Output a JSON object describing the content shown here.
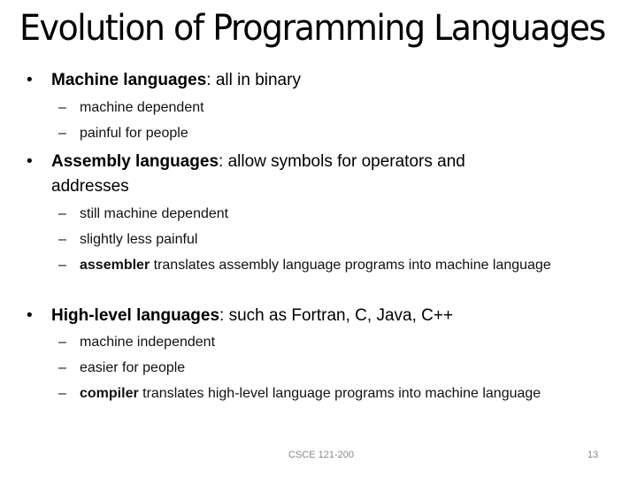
{
  "slide": {
    "title": "Evolution of Programming Languages",
    "bullets": [
      {
        "term": "Machine languages",
        "rest": ":  all in binary",
        "subs": [
          {
            "bold": "",
            "text": "machine dependent"
          },
          {
            "bold": "",
            "text": "painful for people"
          }
        ]
      },
      {
        "term": "Assembly languages",
        "rest": ":  allow symbols for operators and addresses",
        "subs": [
          {
            "bold": "",
            "text": "still machine dependent"
          },
          {
            "bold": "",
            "text": "slightly less painful"
          },
          {
            "bold": "assembler",
            "text": " translates assembly language programs into machine language"
          }
        ]
      },
      {
        "term": "High-level languages",
        "rest": ":  such as Fortran, C, Java, C++",
        "subs": [
          {
            "bold": "",
            "text": "machine independent"
          },
          {
            "bold": "",
            "text": "easier for people"
          },
          {
            "bold": "compiler",
            "text": " translates high-level language programs into machine language"
          }
        ]
      }
    ],
    "bullet_glyph": "•",
    "dash_glyph": "–",
    "footer_center": "CSCE 121-200",
    "page_number": "13"
  }
}
